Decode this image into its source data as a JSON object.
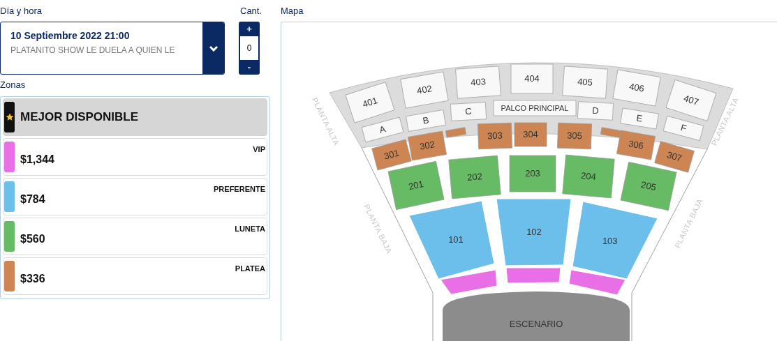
{
  "date": {
    "label": "Día y hora",
    "value": "10 Septiembre 2022 21:00",
    "event": "PLATANITO SHOW LE DUELA A QUIEN LE"
  },
  "quantity": {
    "label": "Cant.",
    "plus": "+",
    "value": "0",
    "minus": "-"
  },
  "zones": {
    "label": "Zonas",
    "items": [
      {
        "kind": "best",
        "title": "MEJOR DISPONIBLE",
        "color": "#111111",
        "selected": true
      },
      {
        "kind": "price",
        "name": "VIP",
        "price": "$1,344",
        "color": "#e86fe6",
        "selected": false
      },
      {
        "kind": "price",
        "name": "PREFERENTE",
        "price": "$784",
        "color": "#6dbfeb",
        "selected": false
      },
      {
        "kind": "price",
        "name": "LUNETA",
        "price": "$560",
        "color": "#66bb64",
        "selected": false
      },
      {
        "kind": "price",
        "name": "PLATEA",
        "price": "$336",
        "color": "#cd8653",
        "selected": false
      }
    ]
  },
  "map": {
    "title": "Mapa",
    "side_labels": [
      "PLANTA ALTA",
      "PLANTA ALTA",
      "PLANTA BAJA",
      "PLANTA BAJA"
    ],
    "stage": "ESCENARIO",
    "sections": [
      {
        "label": "401",
        "color": "#f8f8f8"
      },
      {
        "label": "402",
        "color": "#f8f8f8"
      },
      {
        "label": "403",
        "color": "#f8f8f8"
      },
      {
        "label": "404",
        "color": "#f8f8f8"
      },
      {
        "label": "405",
        "color": "#f8f8f8"
      },
      {
        "label": "406",
        "color": "#f8f8f8"
      },
      {
        "label": "407",
        "color": "#f8f8f8"
      },
      {
        "label": "A",
        "color": "#f8f8f8"
      },
      {
        "label": "B",
        "color": "#f8f8f8"
      },
      {
        "label": "C",
        "color": "#f8f8f8"
      },
      {
        "label": "PALCO PRINCIPAL",
        "color": "#f8f8f8"
      },
      {
        "label": "D",
        "color": "#f8f8f8"
      },
      {
        "label": "E",
        "color": "#f8f8f8"
      },
      {
        "label": "F",
        "color": "#f8f8f8"
      },
      {
        "label": "301",
        "color": "#cd8653"
      },
      {
        "label": "302",
        "color": "#cd8653"
      },
      {
        "color": "#cd8653"
      },
      {
        "label": "303",
        "color": "#cd8653"
      },
      {
        "label": "304",
        "color": "#cd8653"
      },
      {
        "label": "305",
        "color": "#cd8653"
      },
      {
        "color": "#cd8653"
      },
      {
        "label": "306",
        "color": "#cd8653"
      },
      {
        "label": "307",
        "color": "#cd8653"
      },
      {
        "label": "201",
        "color": "#66bb64"
      },
      {
        "label": "202",
        "color": "#66bb64"
      },
      {
        "label": "203",
        "color": "#66bb64"
      },
      {
        "label": "204",
        "color": "#66bb64"
      },
      {
        "label": "205",
        "color": "#66bb64"
      },
      {
        "label": "101",
        "color": "#6dbfeb"
      },
      {
        "label": "102",
        "color": "#6dbfeb"
      },
      {
        "label": "103",
        "color": "#6dbfeb"
      },
      {
        "color": "#e86fe6"
      },
      {
        "color": "#e86fe6"
      },
      {
        "color": "#e86fe6"
      }
    ]
  }
}
